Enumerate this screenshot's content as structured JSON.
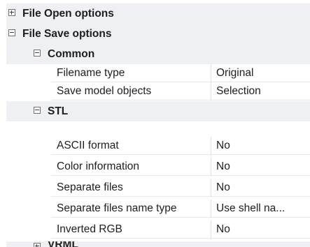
{
  "categories": {
    "file_open": {
      "label": "File Open options",
      "expanded": false
    },
    "file_save": {
      "label": "File Save options",
      "expanded": true
    },
    "common": {
      "label": "Common",
      "expanded": true
    },
    "stl": {
      "label": "STL",
      "expanded": true
    },
    "cutoff": {
      "label": "VRML"
    }
  },
  "common_props": [
    {
      "name": "Filename type",
      "value": "Original"
    },
    {
      "name": "Save model objects",
      "value": "Selection"
    }
  ],
  "stl_props": [
    {
      "name": "ASCII format",
      "value": "No"
    },
    {
      "name": "Color information",
      "value": "No"
    },
    {
      "name": "Separate files",
      "value": "No"
    },
    {
      "name": "Separate files name type",
      "value": "Use shell na..."
    },
    {
      "name": "Inverted RGB",
      "value": "No"
    }
  ],
  "icons": {
    "collapsed": "expand-plus-icon",
    "expanded": "collapse-minus-icon"
  }
}
